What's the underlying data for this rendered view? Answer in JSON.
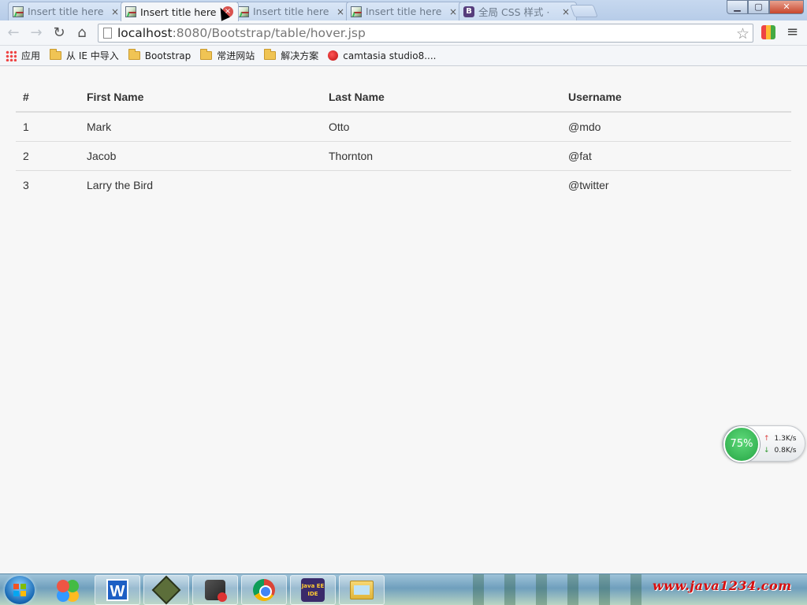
{
  "browser": {
    "tabs": [
      {
        "title": "Insert title here",
        "favicon": "page-image-icon",
        "active": false
      },
      {
        "title": "Insert title here",
        "favicon": "page-image-icon",
        "active": true
      },
      {
        "title": "Insert title here",
        "favicon": "page-image-icon",
        "active": false
      },
      {
        "title": "Insert title here",
        "favicon": "page-image-icon",
        "active": false
      },
      {
        "title": "全局 CSS 样式 ·",
        "favicon": "bootstrap-icon",
        "active": false
      }
    ],
    "tab_close_glyph": "×",
    "bootstrap_glyph": "B",
    "window_controls": {
      "minimize": "▁",
      "maximize": "▢",
      "close": "✕"
    },
    "nav": {
      "back": "←",
      "forward": "→",
      "reload": "↻",
      "home": "⌂"
    },
    "address": {
      "host": "localhost",
      "rest": ":8080/Bootstrap/table/hover.jsp"
    },
    "star_glyph": "☆",
    "menu_glyph": "≡",
    "bookmarks": [
      {
        "label": "应用",
        "icon": "apps-icon"
      },
      {
        "label": "从 IE 中导入",
        "icon": "folder-icon"
      },
      {
        "label": "Bootstrap",
        "icon": "folder-icon"
      },
      {
        "label": "常进网站",
        "icon": "folder-icon"
      },
      {
        "label": "解决方案",
        "icon": "folder-icon"
      },
      {
        "label": "camtasia studio8....",
        "icon": "camtasia-icon"
      }
    ]
  },
  "table": {
    "headers": [
      "#",
      "First Name",
      "Last Name",
      "Username"
    ],
    "rows": [
      [
        "1",
        "Mark",
        "Otto",
        "@mdo"
      ],
      [
        "2",
        "Jacob",
        "Thornton",
        "@fat"
      ],
      [
        "3",
        "Larry the Bird",
        "",
        "@twitter"
      ]
    ]
  },
  "net_widget": {
    "usage": "75%",
    "upload": "1.3K/s",
    "download": "0.8K/s",
    "up_glyph": "↑",
    "down_glyph": "↓"
  },
  "taskbar": {
    "apps": [
      "windows-start-icon",
      "app-balls-icon",
      "wps-writer-icon",
      "green-app-icon",
      "gear-app-icon",
      "chrome-icon",
      "java-ee-ide-icon",
      "file-explorer-icon"
    ],
    "javaee_label": "Java EE IDE",
    "watermark": "www.java1234.com"
  },
  "colors": {
    "accent": "#563d7c",
    "table_border": "#dddddd",
    "watermark": "#d80f0f"
  }
}
